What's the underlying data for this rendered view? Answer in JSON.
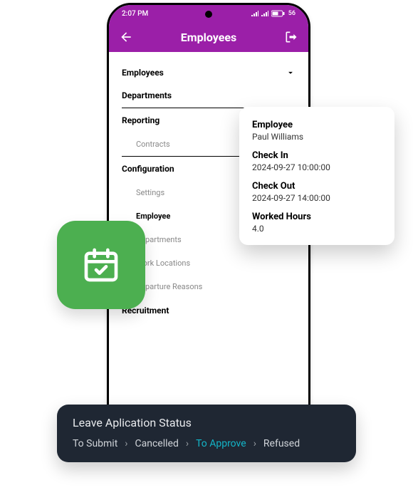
{
  "statusbar": {
    "time": "2:07 PM",
    "battery": "56"
  },
  "appbar": {
    "title": "Employees"
  },
  "nav": {
    "collapsible": "Employees",
    "items": [
      "Departments",
      "Reporting"
    ],
    "sub_reporting": "Contracts",
    "config_head": "Configuration",
    "config_items": [
      "Settings",
      "Employee",
      "Departments",
      "Work Locations",
      "Departure Reasons"
    ],
    "recruitment_head": "Recruitment"
  },
  "card": {
    "employee_label": "Employee",
    "employee_value": "Paul Williams",
    "checkin_label": "Check In",
    "checkin_value": "2024-09-27  10:00:00",
    "checkout_label": "Check Out",
    "checkout_value": "2024-09-27  14:00:00",
    "worked_label": "Worked Hours",
    "worked_value": "4.0"
  },
  "status": {
    "title": "Leave Aplication Status",
    "steps": [
      "To Submit",
      "Cancelled",
      "To Approve",
      "Refused"
    ],
    "active_index": 2
  }
}
